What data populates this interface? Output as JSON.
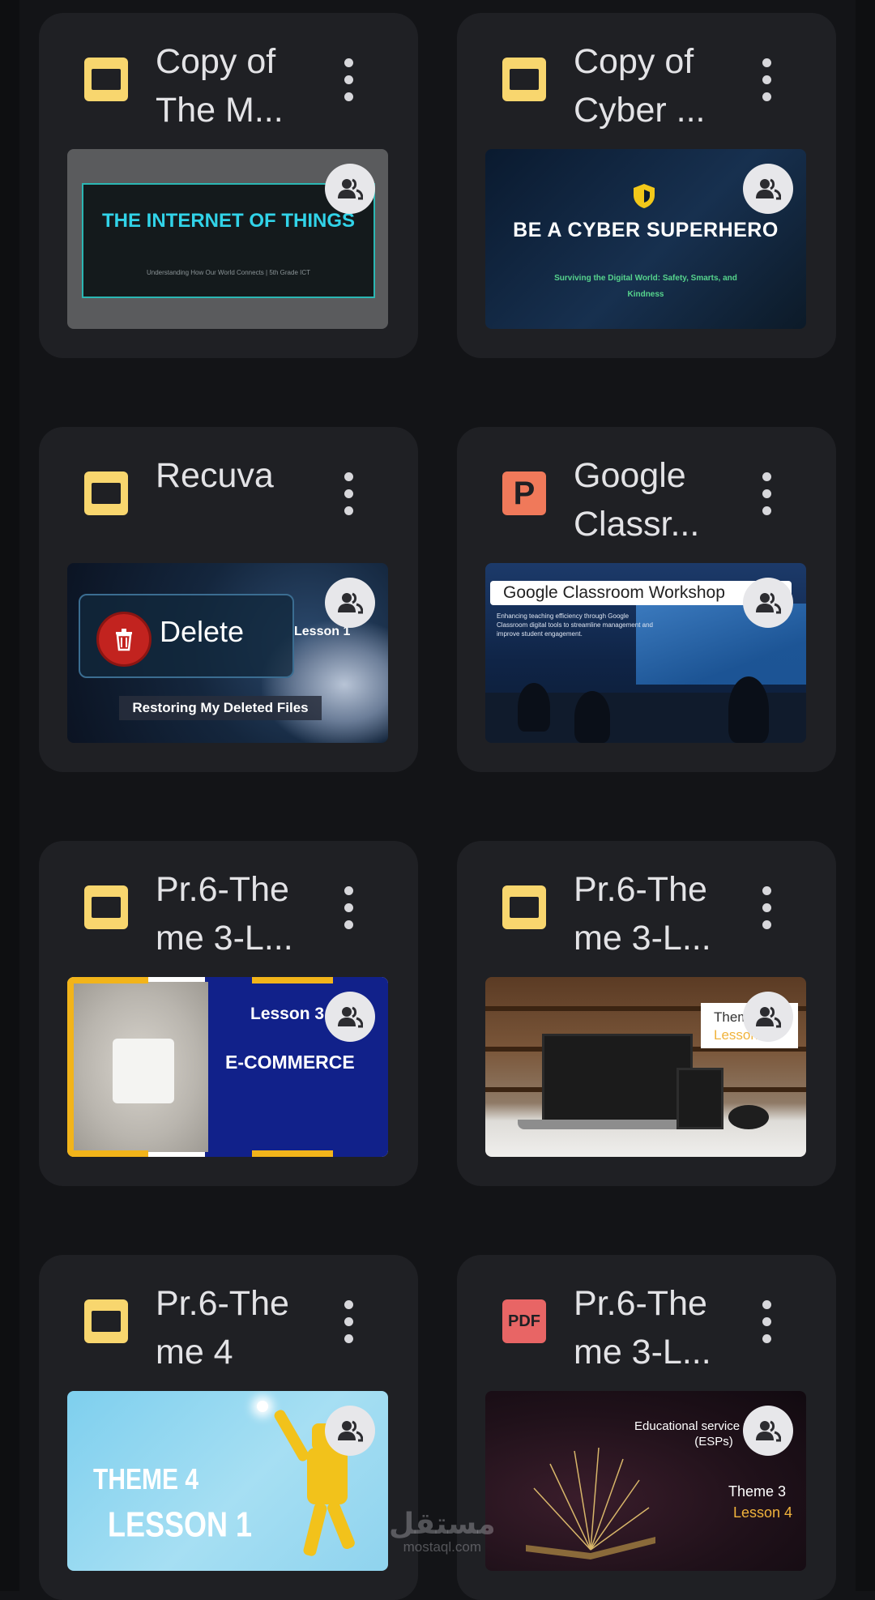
{
  "files": [
    {
      "title": "Copy of\nThe M...",
      "type": "slides",
      "thumb": {
        "kind": "iot",
        "heading": "THE INTERNET OF THINGS",
        "subtitle": "Understanding How Our World Connects | 5th Grade ICT"
      }
    },
    {
      "title": "Copy of\nCyber ...",
      "type": "slides",
      "thumb": {
        "kind": "cyber",
        "heading": "BE A CYBER SUPERHERO",
        "subtitle": "Surviving the Digital World: Safety, Smarts, and Kindness"
      }
    },
    {
      "title": "Recuva",
      "type": "slides",
      "thumb": {
        "kind": "recuva",
        "button": "Delete",
        "lesson": "Lesson 1",
        "caption": "Restoring My Deleted Files"
      }
    },
    {
      "title": "Google\nClassr...",
      "type": "powerpoint",
      "thumb": {
        "kind": "gclass",
        "banner": "Google Classroom Workshop",
        "subtitle": "Enhancing teaching efficiency through Google Classroom digital tools to streamline management and improve student engagement."
      }
    },
    {
      "title": "Pr.6-The\nme 3-L...",
      "type": "slides",
      "thumb": {
        "kind": "ecom",
        "lesson": "Lesson 3",
        "heading": "E-COMMERCE"
      }
    },
    {
      "title": "Pr.6-The\nme 3-L...",
      "type": "slides",
      "thumb": {
        "kind": "lib",
        "theme": "Theme",
        "lesson": "Lesson 5"
      }
    },
    {
      "title": "Pr.6-The\nme 4",
      "type": "slides",
      "thumb": {
        "kind": "theme4",
        "theme": "THEME 4",
        "lesson": "LESSON 1"
      }
    },
    {
      "title": "Pr.6-The\nme 3-L...",
      "type": "pdf",
      "thumb": {
        "kind": "esp",
        "line1": "Educational service providers (ESPs)",
        "theme": "Theme 3",
        "lesson": "Lesson 4"
      }
    }
  ],
  "icons": {
    "ppt_letter": "P",
    "pdf_label": "PDF"
  },
  "colors": {
    "slides": "#f8d66e",
    "powerpoint": "#f0795a",
    "pdf": "#e86565",
    "card_bg": "#1f2024",
    "page_bg": "#131417"
  },
  "watermark": {
    "arabic": "مستقل",
    "latin": "mostaql.com"
  }
}
